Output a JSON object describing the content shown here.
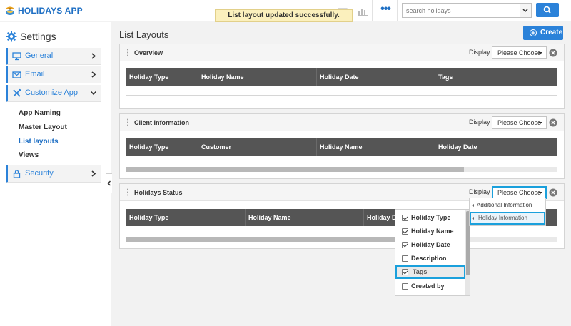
{
  "app": {
    "title": "HOLIDAYS APP",
    "logo_icon": "holiday-app-logo-icon"
  },
  "notification": {
    "message": "List layout updated successfully."
  },
  "topbar": {
    "more_label": "•••",
    "search": {
      "placeholder": "search holidays",
      "value": ""
    },
    "icons": [
      "gift-icon",
      "bar-chart-icon",
      "more-dots-icon",
      "search-icon"
    ]
  },
  "sidebar": {
    "title": "Settings",
    "items": [
      {
        "label": "General",
        "icon": "monitor-icon",
        "expanded": false
      },
      {
        "label": "Email",
        "icon": "envelope-icon",
        "expanded": false
      },
      {
        "label": "Customize App",
        "icon": "tools-icon",
        "expanded": true
      },
      {
        "label": "Security",
        "icon": "lock-icon",
        "expanded": false
      }
    ],
    "subitems": [
      {
        "label": "App Naming",
        "active": false
      },
      {
        "label": "Master Layout",
        "active": false
      },
      {
        "label": "List layouts",
        "active": true
      },
      {
        "label": "Views",
        "active": false
      }
    ]
  },
  "main": {
    "title": "List Layouts",
    "create_label": "Create",
    "display_label": "Display",
    "dropdown_default": "Please Choose",
    "panels": [
      {
        "title": "Overview",
        "columns": [
          "Holiday Type",
          "Holiday Name",
          "Holiday Date",
          "Tags"
        ],
        "has_scrollbar": false
      },
      {
        "title": "Client Information",
        "columns": [
          "Holiday Type",
          "Customer",
          "Holiday Name",
          "Holiday Date"
        ],
        "has_scrollbar": true
      },
      {
        "title": "Holidays Status",
        "columns": [
          "Holiday Type",
          "Holiday Name",
          "Holiday D"
        ],
        "has_scrollbar": true
      }
    ]
  },
  "display_menu": {
    "items": [
      {
        "label": "Additional Information",
        "highlighted": false
      },
      {
        "label": "Holiday Information",
        "highlighted": true
      }
    ]
  },
  "column_menu": {
    "items": [
      {
        "label": "Holiday Type",
        "checked": true,
        "highlighted": false
      },
      {
        "label": "Holiday Name",
        "checked": true,
        "highlighted": false
      },
      {
        "label": "Holiday Date",
        "checked": true,
        "highlighted": false
      },
      {
        "label": "Description",
        "checked": false,
        "highlighted": false
      },
      {
        "label": "Tags",
        "checked": true,
        "highlighted": true
      },
      {
        "label": "Created by",
        "checked": false,
        "highlighted": false
      }
    ]
  },
  "colors": {
    "accent": "#2b82d9",
    "highlight_border": "#1aa0dc",
    "table_header": "#555555",
    "toast": "#fbf0bd"
  }
}
